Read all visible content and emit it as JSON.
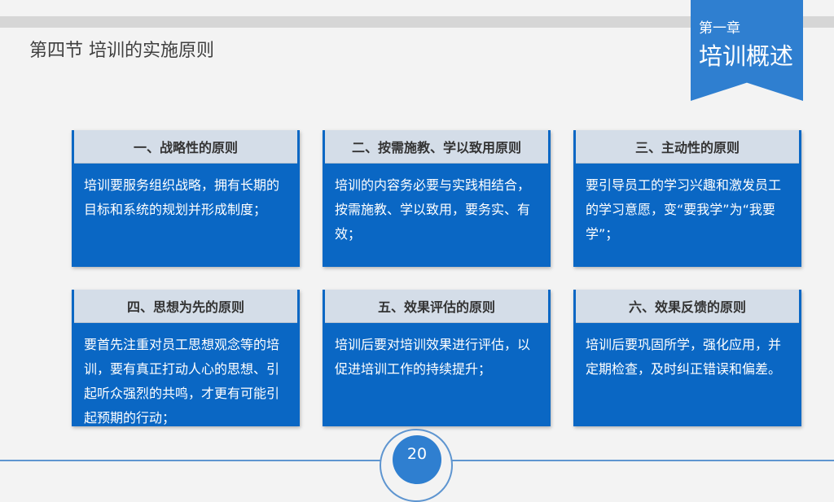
{
  "header": {
    "section_title": "第四节  培训的实施原则",
    "chapter_label": "第一章",
    "chapter_name": "培训概述"
  },
  "cards": [
    {
      "title": "一、战略性的原则",
      "body": "培训要服务组织战略，拥有长期的目标和系统的规划并形成制度；"
    },
    {
      "title": "二、按需施教、学以致用原则",
      "body": "培训的内容务必要与实践相结合，按需施教、学以致用，要务实、有效；"
    },
    {
      "title": "三、主动性的原则",
      "body": "要引导员工的学习兴趣和激发员工的学习意愿，变“要我学”为“我要学”；"
    },
    {
      "title": "四、思想为先的原则",
      "body": "要首先注重对员工思想观念等的培训，要有真正打动人心的思想、引起听众强烈的共鸣，才更有可能引起预期的行动；"
    },
    {
      "title": "五、效果评估的原则",
      "body": "培训后要对培训效果进行评估，以促进培训工作的持续提升；"
    },
    {
      "title": "六、效果反馈的原则",
      "body": "培训后要巩固所学，强化应用，并定期检查，及时纠正错误和偏差。"
    }
  ],
  "footer": {
    "page_number": "20"
  },
  "colors": {
    "card_blue": "#0a67c4",
    "card_header": "#d4dde8",
    "banner_blue": "#2f7fd0"
  }
}
